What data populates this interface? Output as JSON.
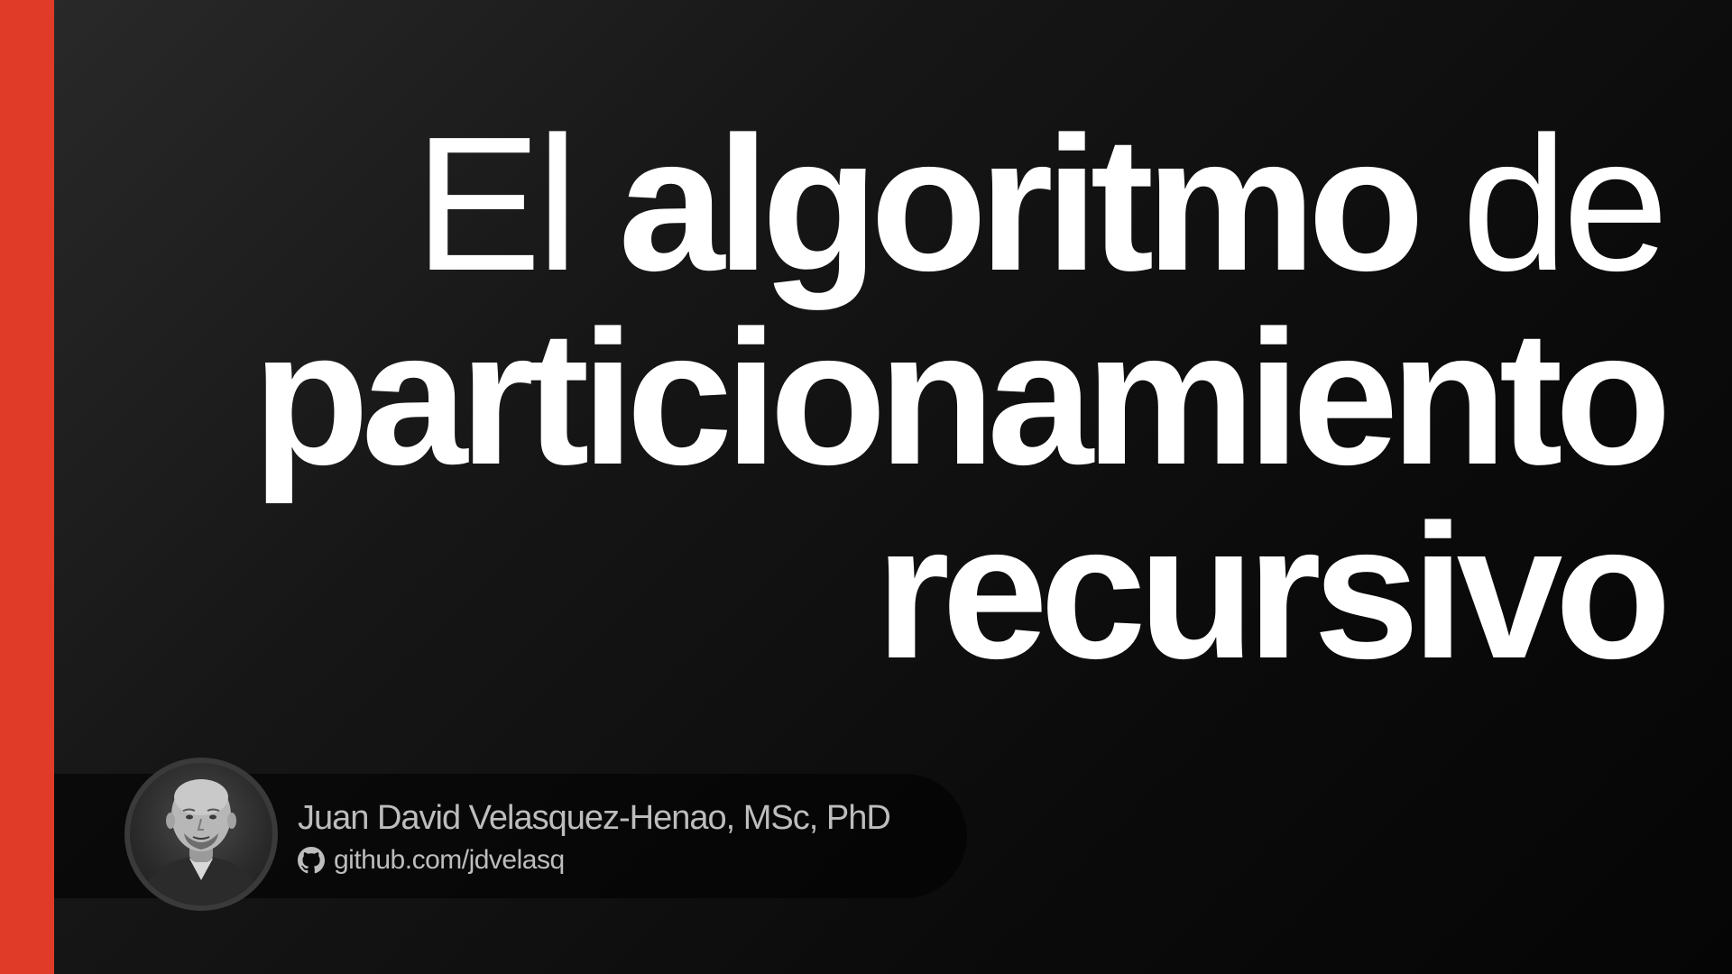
{
  "slide": {
    "title": {
      "line1_light_a": "El",
      "line1_bold": "algoritmo",
      "line1_light_b": "de",
      "line2_bold": "particionamiento",
      "line3_bold": "recursivo"
    },
    "author": {
      "name": "Juan David Velasquez-Henao, MSc, PhD",
      "link_text": "github.com/jdvelasq",
      "link_icon": "github-icon",
      "avatar_icon": "person-photo"
    }
  },
  "colors": {
    "accent": "#e03a28",
    "background": "#0c0c0c",
    "title_text": "#ffffff",
    "author_text": "#bdbdbd"
  }
}
